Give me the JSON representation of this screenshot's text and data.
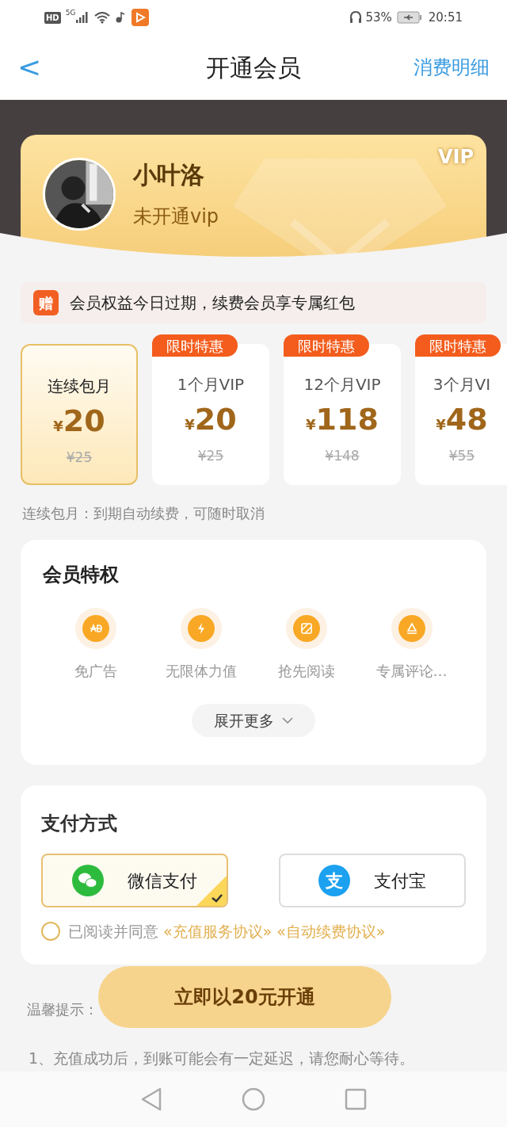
{
  "status_bar": {
    "hd": "HD",
    "network": "5G",
    "battery_percent": "53%",
    "time": "20:51"
  },
  "nav": {
    "back": "<",
    "title": "开通会员",
    "action": "消费明细"
  },
  "profile": {
    "badge": "VIP",
    "name": "小叶洛",
    "status": "未开通vip"
  },
  "gift_banner": {
    "icon": "赠",
    "text": "会员权益今日过期，续费会员享专属红包"
  },
  "plans": [
    {
      "name": "连续包月",
      "currency": "¥",
      "price": "20",
      "original": "¥25",
      "selected": true
    },
    {
      "tag": "限时特惠",
      "name": "1个月VIP",
      "currency": "¥",
      "price": "20",
      "original": "¥25",
      "selected": false
    },
    {
      "tag": "限时特惠",
      "name": "12个月VIP",
      "currency": "¥",
      "price": "118",
      "original": "¥148",
      "selected": false
    },
    {
      "tag": "限时特惠",
      "name": "3个月VI",
      "currency": "¥",
      "price": "48",
      "original": "¥55",
      "selected": false
    }
  ],
  "plan_note": "连续包月：到期自动续费，可随时取消",
  "privileges": {
    "title": "会员特权",
    "items": [
      {
        "kind": "ad",
        "label": "免广告"
      },
      {
        "kind": "energy",
        "label": "无限体力值"
      },
      {
        "kind": "read",
        "label": "抢先阅读"
      },
      {
        "kind": "comment",
        "label": "专属评论…"
      }
    ],
    "more": "展开更多"
  },
  "payment": {
    "title": "支付方式",
    "methods": [
      {
        "kind": "wechat",
        "label": "微信支付",
        "selected": true
      },
      {
        "kind": "alipay",
        "icon": "支",
        "label": "支付宝",
        "selected": false
      }
    ],
    "agreement": {
      "checked": false,
      "text": "已阅读并同意",
      "links": [
        "«充值服务协议»",
        "«自动续费协议»"
      ]
    }
  },
  "tips_label": "温馨提示：",
  "submit": "立即以20元开通",
  "tips": [
    "1、充值成功后，到账可能会有一定延迟，请您耐心等待。"
  ]
}
